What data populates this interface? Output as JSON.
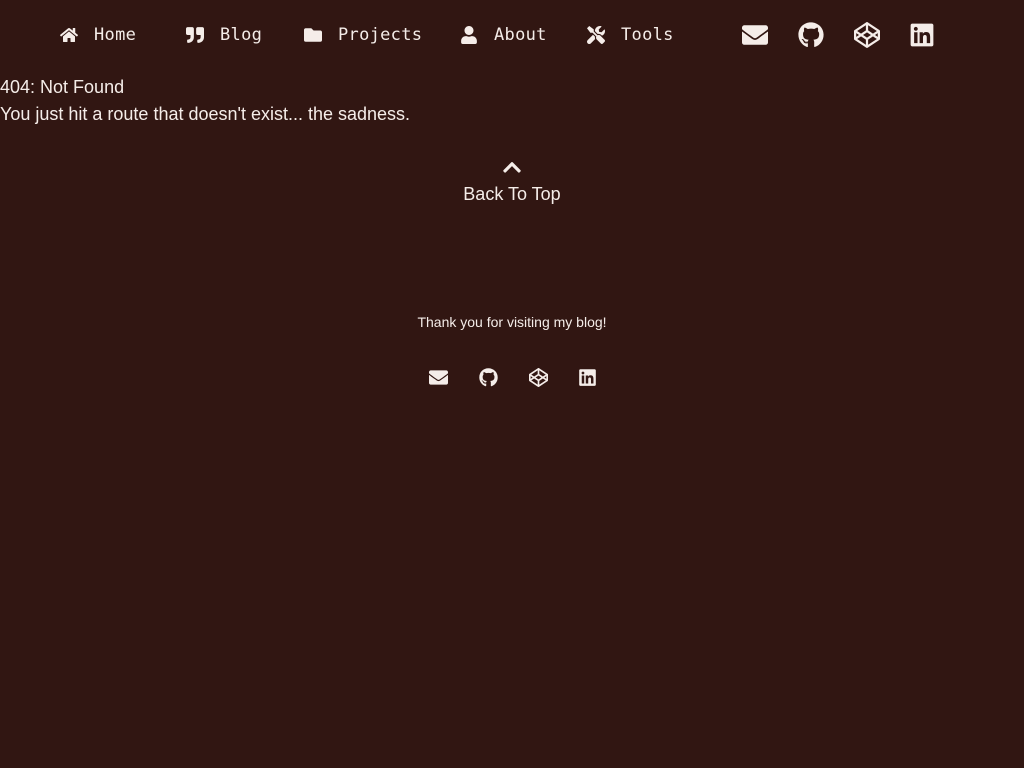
{
  "nav": {
    "items": [
      {
        "label": "Home",
        "icon": "home-icon"
      },
      {
        "label": "Blog",
        "icon": "quote-icon"
      },
      {
        "label": "Projects",
        "icon": "folder-icon"
      },
      {
        "label": "About",
        "icon": "user-icon"
      },
      {
        "label": "Tools",
        "icon": "tools-icon"
      }
    ],
    "social": [
      {
        "icon": "envelope-icon"
      },
      {
        "icon": "github-icon"
      },
      {
        "icon": "codepen-icon"
      },
      {
        "icon": "linkedin-icon"
      }
    ]
  },
  "error": {
    "title": "404: Not Found",
    "message": "You just hit a route that doesn't exist... the sadness."
  },
  "back_to_top": {
    "label": "Back To Top",
    "icon": "chevron-up-icon"
  },
  "footer": {
    "note": "Thank you for visiting my blog!",
    "social": [
      {
        "icon": "envelope-icon"
      },
      {
        "icon": "github-icon"
      },
      {
        "icon": "codepen-icon"
      },
      {
        "icon": "linkedin-icon"
      }
    ]
  },
  "colors": {
    "background": "#311612",
    "text": "#f5ede9"
  }
}
